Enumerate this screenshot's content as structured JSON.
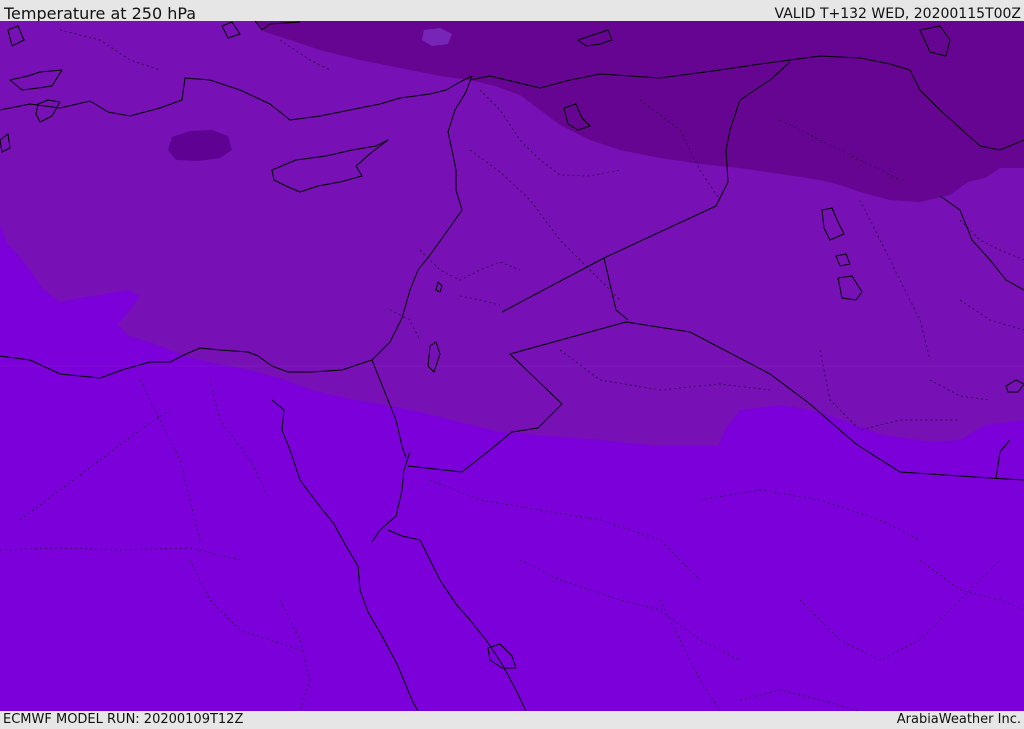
{
  "header": {
    "title": "Temperature at 250 hPa",
    "valid": "VALID T+132 WED, 20200115T00Z"
  },
  "footer": {
    "model_run": "ECMWF MODEL RUN: 20200109T12Z",
    "credit": "ArabiaWeather Inc."
  },
  "colors": {
    "warmest_band": "#7b00d9",
    "middle_band": "#7710b5",
    "cold_band": "#670593",
    "cold_spot": "#5f0293",
    "coastline": "#000000"
  }
}
